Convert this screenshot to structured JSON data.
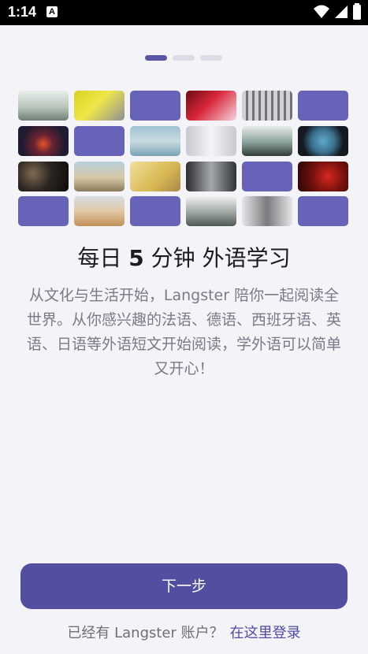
{
  "status_bar": {
    "time": "1:14",
    "notification_icon": "A",
    "icons": [
      "wifi-icon",
      "signal-icon",
      "battery-icon"
    ]
  },
  "pager": {
    "pages": 3,
    "active_index": 0
  },
  "tiles": [
    {
      "kind": "photo",
      "name": "misty-forest-photo",
      "bg": "linear-gradient(180deg,#e9eeea 0%,#b8c5bc 55%,#6f7f73 100%)"
    },
    {
      "kind": "photo",
      "name": "yellow-room-photo",
      "bg": "linear-gradient(135deg,#d9d21f 0%,#f0e64a 45%,#8e8f95 100%)"
    },
    {
      "kind": "placeholder"
    },
    {
      "kind": "photo",
      "name": "red-neon-photo",
      "bg": "linear-gradient(135deg,#6b0a14 0%,#d9283b 45%,#f4d4dc 100%)"
    },
    {
      "kind": "photo",
      "name": "building-facade-photo",
      "bg": "repeating-linear-gradient(90deg,#cfd1d4 0,#cfd1d4 5px,#6f7378 5px,#6f7378 8px)"
    },
    {
      "kind": "placeholder"
    },
    {
      "kind": "photo",
      "name": "night-sky-photo",
      "bg": "radial-gradient(circle at 50% 60%,#e5522a 0%,#6a2332 30%,#1f1b30 70%)"
    },
    {
      "kind": "placeholder"
    },
    {
      "kind": "photo",
      "name": "sea-sky-photo",
      "bg": "linear-gradient(180deg,#9ec2d2 0%,#c9dae0 50%,#7aa3b5 100%)"
    },
    {
      "kind": "photo",
      "name": "fog-glare-photo",
      "bg": "linear-gradient(90deg,#c7c9cf 0%,#f4f3f8 50%,#c7c9cf 100%)"
    },
    {
      "kind": "photo",
      "name": "pine-tree-photo",
      "bg": "linear-gradient(180deg,#e8ece9 0%,#8aa09a 55%,#2e3b37 100%)"
    },
    {
      "kind": "photo",
      "name": "airplane-circle-photo",
      "bg": "radial-gradient(circle at 50% 50%,#5fa9c9 0%,#3b6f8c 40%,#141820 70%)"
    },
    {
      "kind": "photo",
      "name": "dark-texture-photo",
      "bg": "radial-gradient(circle at 30% 40%,#7d6a55 0%,#2d2620 45%,#0d0b0a 100%)"
    },
    {
      "kind": "photo",
      "name": "beach-crowd-photo",
      "bg": "linear-gradient(180deg,#b7d0de 0%,#d6c7a3 55%,#8a7a5e 100%)"
    },
    {
      "kind": "photo",
      "name": "yellow-wall-photo",
      "bg": "linear-gradient(135deg,#efe09a 0%,#d8b652 60%,#a7884a 100%)"
    },
    {
      "kind": "photo",
      "name": "waterfall-photo",
      "bg": "linear-gradient(90deg,#2a2c2f 0%,#a4a8ad 50%,#2f3236 100%)"
    },
    {
      "kind": "placeholder"
    },
    {
      "kind": "photo",
      "name": "red-smoke-photo",
      "bg": "radial-gradient(circle at 60% 50%,#d6291f 0%,#7a120f 45%,#240606 100%)"
    },
    {
      "kind": "placeholder"
    },
    {
      "kind": "photo",
      "name": "beach-woman-photo",
      "bg": "linear-gradient(180deg,#d5dde4 0%,#e2c9a6 50%,#c18e57 100%)"
    },
    {
      "kind": "placeholder"
    },
    {
      "kind": "photo",
      "name": "mountain-lake-photo",
      "bg": "linear-gradient(180deg,#f2f2f3 0%,#9da59f 55%,#4f5a55 100%)"
    },
    {
      "kind": "photo",
      "name": "person-portrait-photo",
      "bg": "linear-gradient(90deg,#e6e6e8 0%,#7b7b7e 50%,#e6e6e8 100%)"
    },
    {
      "kind": "placeholder"
    }
  ],
  "headline": {
    "pre": "每日 ",
    "bold": "5",
    "post": " 分钟 外语学习"
  },
  "description": "从文化与生活开始，Langster 陪你一起阅读全世界。从你感兴趣的法语、德语、西班牙语、英语、日语等外语短文开始阅读，学外语可以简单又开心！",
  "next_button": {
    "label": "下一步"
  },
  "login": {
    "prompt": "已经有 Langster 账户？",
    "link": "在这里登录"
  },
  "colors": {
    "accent": "#524ea0",
    "placeholder_tile": "#6663b8",
    "background": "#f4f3f8"
  }
}
